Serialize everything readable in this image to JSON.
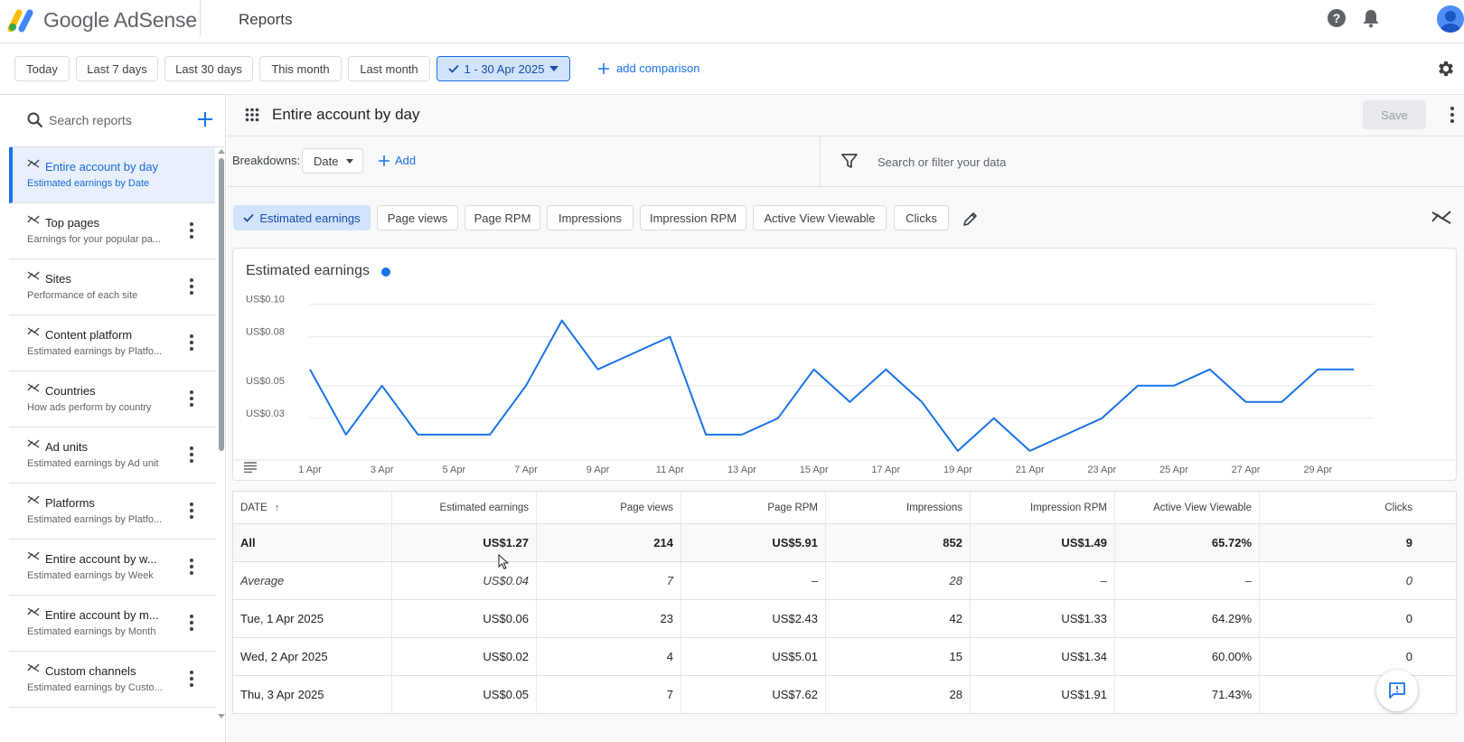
{
  "brand": {
    "name": "Google AdSense",
    "page_title": "Reports"
  },
  "date_bar": {
    "presets": [
      {
        "label": "Today"
      },
      {
        "label": "Last 7 days"
      },
      {
        "label": "Last 30 days"
      },
      {
        "label": "This month"
      },
      {
        "label": "Last month"
      }
    ],
    "selected_range": "1 - 30 Apr 2025",
    "add_comparison": "add comparison"
  },
  "sidebar": {
    "search_placeholder": "Search reports",
    "items": [
      {
        "title": "Entire account by day",
        "subtitle": "Estimated earnings by Date",
        "active": true
      },
      {
        "title": "Top pages",
        "subtitle": "Earnings for your popular pa..."
      },
      {
        "title": "Sites",
        "subtitle": "Performance of each site"
      },
      {
        "title": "Content platform",
        "subtitle": "Estimated earnings by Platfo..."
      },
      {
        "title": "Countries",
        "subtitle": "How ads perform by country"
      },
      {
        "title": "Ad units",
        "subtitle": "Estimated earnings by Ad unit"
      },
      {
        "title": "Platforms",
        "subtitle": "Estimated earnings by Platfo..."
      },
      {
        "title": "Entire account by w...",
        "subtitle": "Estimated earnings by Week"
      },
      {
        "title": "Entire account by m...",
        "subtitle": "Estimated earnings by Month"
      },
      {
        "title": "Custom channels",
        "subtitle": "Estimated earnings by Custo..."
      }
    ]
  },
  "report": {
    "title": "Entire account by day",
    "save_label": "Save",
    "breakdowns_label": "Breakdowns:",
    "breakdown_value": "Date",
    "add_label": "Add",
    "filter_placeholder": "Search or filter your data",
    "metrics": [
      {
        "label": "Estimated earnings",
        "selected": true
      },
      {
        "label": "Page views"
      },
      {
        "label": "Page RPM"
      },
      {
        "label": "Impressions"
      },
      {
        "label": "Impression RPM"
      },
      {
        "label": "Active View Viewable"
      },
      {
        "label": "Clicks"
      }
    ]
  },
  "colors": {
    "accent": "#1a73e8",
    "line": "#1a73e8"
  },
  "chart_data": {
    "type": "line",
    "title": "Estimated earnings",
    "x": [
      "1 Apr",
      "2 Apr",
      "3 Apr",
      "4 Apr",
      "5 Apr",
      "6 Apr",
      "7 Apr",
      "8 Apr",
      "9 Apr",
      "10 Apr",
      "11 Apr",
      "12 Apr",
      "13 Apr",
      "14 Apr",
      "15 Apr",
      "16 Apr",
      "17 Apr",
      "18 Apr",
      "19 Apr",
      "20 Apr",
      "21 Apr",
      "22 Apr",
      "23 Apr",
      "24 Apr",
      "25 Apr",
      "26 Apr",
      "27 Apr",
      "28 Apr",
      "29 Apr",
      "30 Apr"
    ],
    "x_tick_labels": [
      "1 Apr",
      "3 Apr",
      "5 Apr",
      "7 Apr",
      "9 Apr",
      "11 Apr",
      "13 Apr",
      "15 Apr",
      "17 Apr",
      "19 Apr",
      "21 Apr",
      "23 Apr",
      "25 Apr",
      "27 Apr",
      "29 Apr"
    ],
    "y_tick_labels": [
      "US$0.10",
      "US$0.08",
      "US$0.05",
      "US$0.03"
    ],
    "y_ticks": [
      0.1,
      0.08,
      0.05,
      0.03
    ],
    "series": [
      {
        "values": [
          0.06,
          0.02,
          0.05,
          0.02,
          0.02,
          0.02,
          0.05,
          0.09,
          0.06,
          0.07,
          0.08,
          0.02,
          0.02,
          0.03,
          0.06,
          0.04,
          0.06,
          0.04,
          0.01,
          0.03,
          0.01,
          0.02,
          0.03,
          0.05,
          0.05,
          0.06,
          0.04,
          0.04,
          0.06,
          0.06
        ]
      }
    ],
    "grid": true,
    "ylim": [
      0.0,
      0.11
    ]
  },
  "table": {
    "columns": [
      "DATE",
      "Estimated earnings",
      "Page views",
      "Page RPM",
      "Impressions",
      "Impression RPM",
      "Active View Viewable",
      "Clicks"
    ],
    "sort_indicator": "↑",
    "rows": [
      {
        "type": "all",
        "cells": [
          "All",
          "US$1.27",
          "214",
          "US$5.91",
          "852",
          "US$1.49",
          "65.72%",
          "9"
        ]
      },
      {
        "type": "avg",
        "cells": [
          "Average",
          "US$0.04",
          "7",
          "–",
          "28",
          "–",
          "–",
          "0"
        ]
      },
      {
        "type": "data",
        "cells": [
          "Tue, 1 Apr 2025",
          "US$0.06",
          "23",
          "US$2.43",
          "42",
          "US$1.33",
          "64.29%",
          "0"
        ]
      },
      {
        "type": "data",
        "cells": [
          "Wed, 2 Apr 2025",
          "US$0.02",
          "4",
          "US$5.01",
          "15",
          "US$1.34",
          "60.00%",
          "0"
        ]
      },
      {
        "type": "data",
        "cells": [
          "Thu, 3 Apr 2025",
          "US$0.05",
          "7",
          "US$7.62",
          "28",
          "US$1.91",
          "71.43%",
          ""
        ]
      }
    ]
  }
}
